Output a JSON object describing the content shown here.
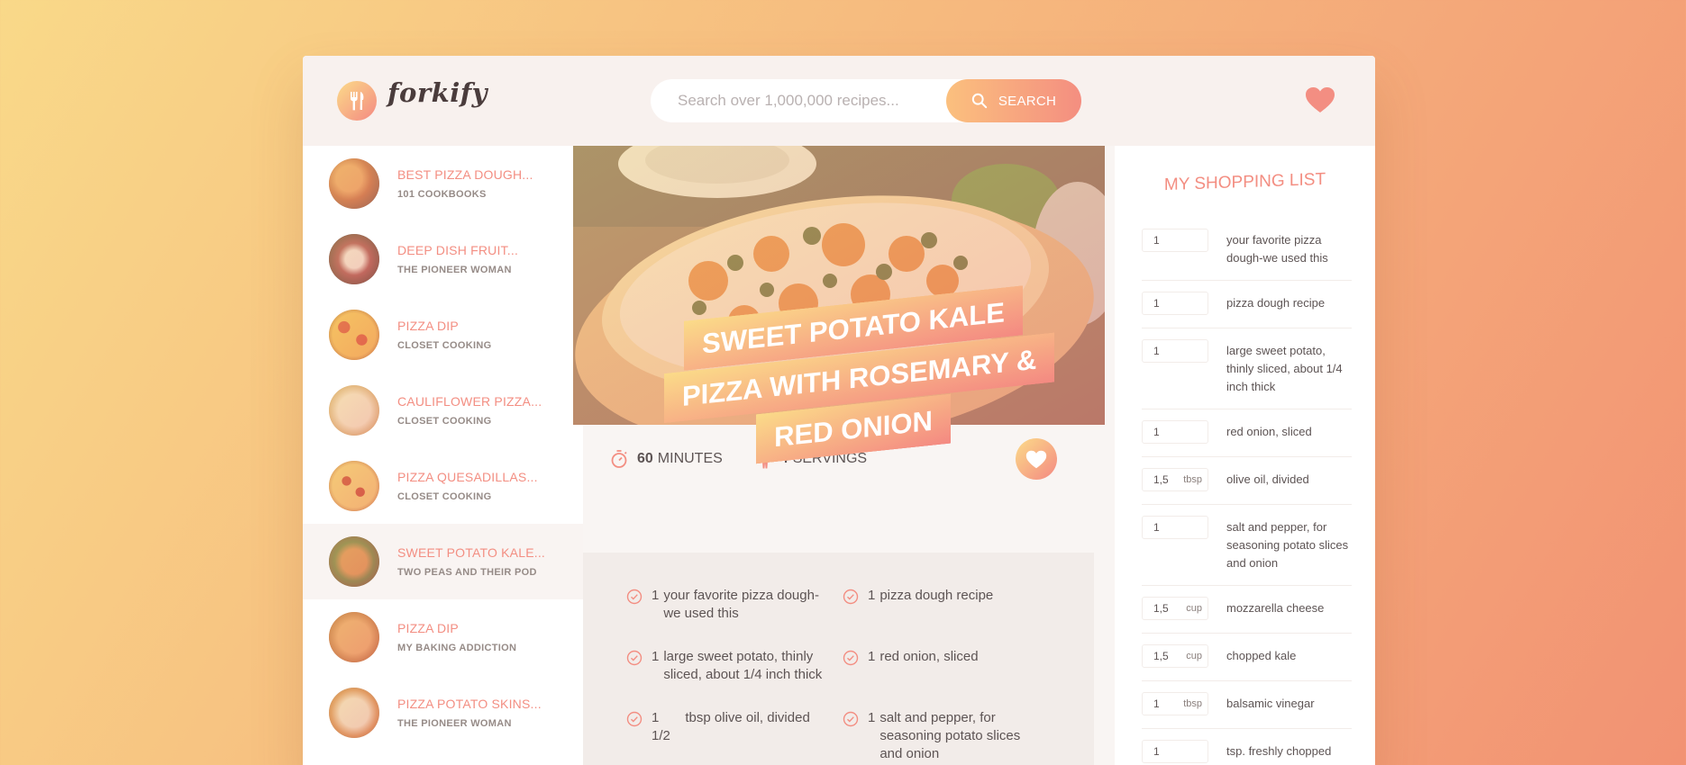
{
  "header": {
    "brand": "forkify",
    "search_placeholder": "Search over 1,000,000 recipes...",
    "search_button": "SEARCH"
  },
  "results": [
    {
      "title": "BEST PIZZA DOUGH...",
      "author": "101 COOKBOOKS"
    },
    {
      "title": "DEEP DISH FRUIT...",
      "author": "THE PIONEER WOMAN"
    },
    {
      "title": "PIZZA DIP",
      "author": "CLOSET COOKING"
    },
    {
      "title": "CAULIFLOWER PIZZA...",
      "author": "CLOSET COOKING"
    },
    {
      "title": "PIZZA QUESADILLAS...",
      "author": "CLOSET COOKING"
    },
    {
      "title": "SWEET POTATO KALE...",
      "author": "TWO PEAS AND THEIR POD"
    },
    {
      "title": "PIZZA DIP",
      "author": "MY BAKING ADDICTION"
    },
    {
      "title": "PIZZA POTATO SKINS...",
      "author": "THE PIONEER WOMAN"
    }
  ],
  "recipe": {
    "title": "SWEET POTATO KALE PIZZA WITH ROSEMARY & RED ONION",
    "minutes": "60",
    "minutes_label": "MINUTES",
    "servings": "4",
    "servings_label": "SERVINGS",
    "ingredients": [
      {
        "count": "1",
        "text": "your favorite pizza dough-we used this"
      },
      {
        "count": "1",
        "text": "pizza dough recipe"
      },
      {
        "count": "1",
        "text": "large sweet potato, thinly sliced, about 1/4 inch thick"
      },
      {
        "count": "1",
        "text": "red onion, sliced"
      },
      {
        "count": "1 1/2",
        "text": "tbsp olive oil, divided"
      },
      {
        "count": "1",
        "text": "salt and pepper, for seasoning potato slices and onion"
      }
    ]
  },
  "shopping": {
    "title": "MY SHOPPING LIST",
    "items": [
      {
        "qty": "1",
        "unit": "",
        "desc": "your favorite pizza dough-we used this"
      },
      {
        "qty": "1",
        "unit": "",
        "desc": "pizza dough recipe"
      },
      {
        "qty": "1",
        "unit": "",
        "desc": "large sweet potato, thinly sliced, about 1/4 inch thick"
      },
      {
        "qty": "1",
        "unit": "",
        "desc": "red onion, sliced"
      },
      {
        "qty": "1,5",
        "unit": "tbsp",
        "desc": "olive oil, divided"
      },
      {
        "qty": "1",
        "unit": "",
        "desc": "salt and pepper, for seasoning potato slices and onion"
      },
      {
        "qty": "1,5",
        "unit": "cup",
        "desc": "mozzarella cheese"
      },
      {
        "qty": "1,5",
        "unit": "cup",
        "desc": "chopped kale"
      },
      {
        "qty": "1",
        "unit": "tbsp",
        "desc": "balsamic vinegar"
      },
      {
        "qty": "1",
        "unit": "",
        "desc": "tsp. freshly chopped"
      }
    ]
  },
  "colors": {
    "accent": "#f38e82",
    "gradient_start": "#fbdb89",
    "gradient_end": "#f48982",
    "text": "#5d5454"
  }
}
